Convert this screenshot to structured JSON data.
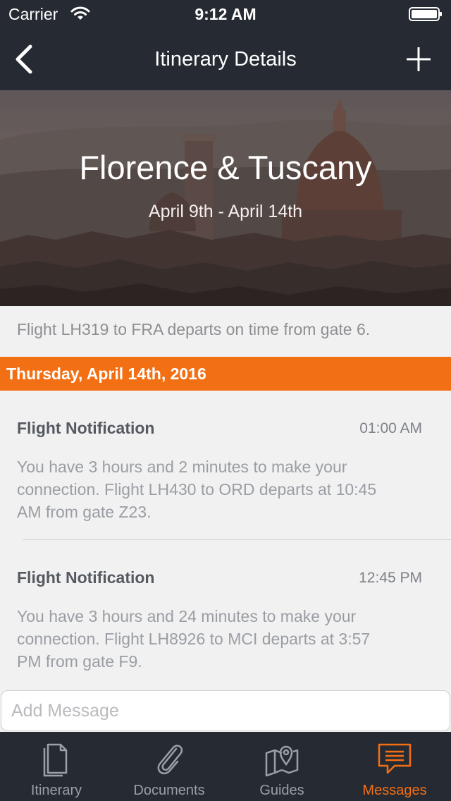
{
  "status_bar": {
    "carrier": "Carrier",
    "time": "9:12 AM"
  },
  "nav": {
    "title": "Itinerary Details"
  },
  "hero": {
    "title": "Florence & Tuscany",
    "dates": "April 9th - April 14th"
  },
  "status_message": "Flight LH319 to FRA departs on time from gate 6.",
  "day_header": "Thursday, April 14th, 2016",
  "messages": [
    {
      "title": "Flight Notification",
      "time": "01:00 AM",
      "lines": [
        "You have 3 hours and 2 minutes to make your",
        "connection. Flight LH430 to ORD departs at 10:45",
        "AM from gate Z23."
      ]
    },
    {
      "title": "Flight Notification",
      "time": "12:45 PM",
      "lines": [
        "You have 3 hours and 24 minutes to make your",
        "connection. Flight LH8926 to MCI departs at 3:57",
        "PM from gate F9."
      ]
    }
  ],
  "composer": {
    "placeholder": "Add Message"
  },
  "tabs": [
    {
      "label": "Itinerary",
      "icon": "document-icon",
      "active": false
    },
    {
      "label": "Documents",
      "icon": "paperclip-icon",
      "active": false
    },
    {
      "label": "Guides",
      "icon": "map-pin-icon",
      "active": false
    },
    {
      "label": "Messages",
      "icon": "chat-icon",
      "active": true
    }
  ],
  "colors": {
    "nav_background": "#262b33",
    "accent": "#f36f14",
    "background": "#f1f1f1",
    "inactive_tab": "#9b9fa6"
  }
}
